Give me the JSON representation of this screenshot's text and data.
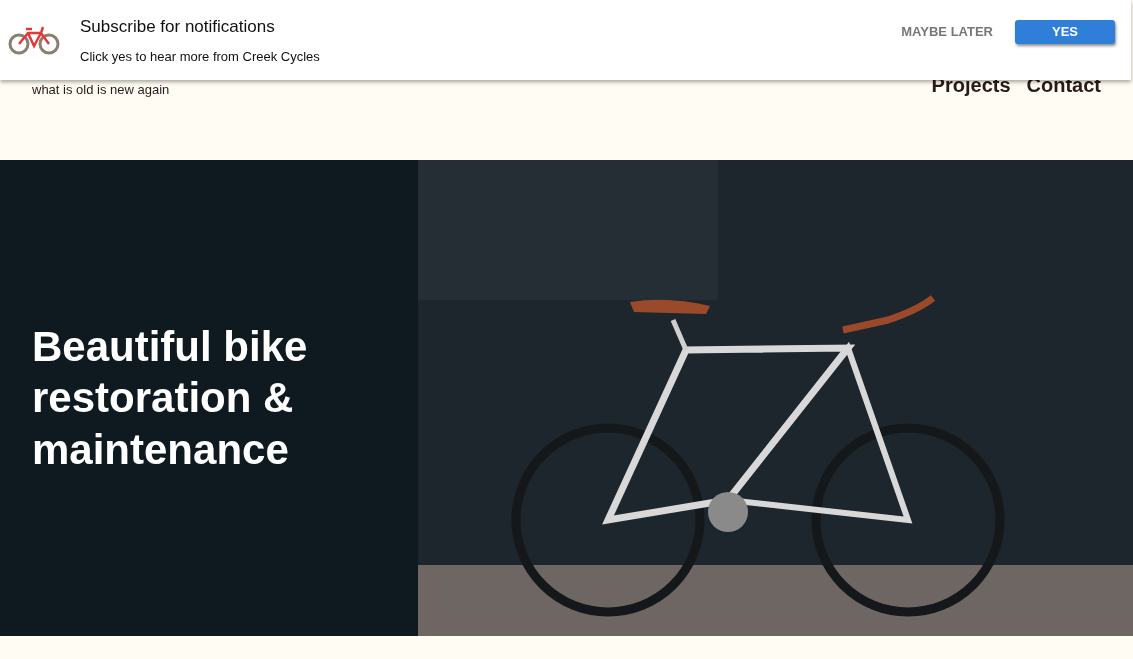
{
  "notification": {
    "title": "Subscribe for notifications",
    "message": "Click yes to hear more from Creek Cycles",
    "buttons": [
      {
        "label": "MAYBE LATER",
        "kind": "secondary"
      },
      {
        "label": "YES",
        "kind": "primary"
      }
    ]
  },
  "header": {
    "tagline": "what is old is new again",
    "nav": [
      "Projects",
      "Contact"
    ]
  },
  "hero": {
    "heading": "Beautiful bike restoration & maintenance"
  }
}
